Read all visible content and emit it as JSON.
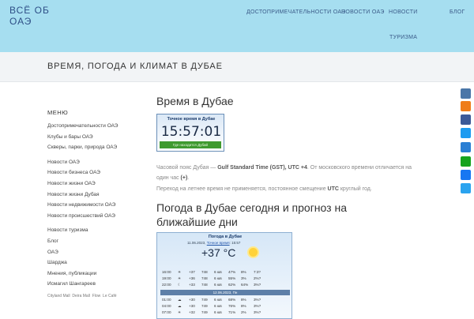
{
  "header": {
    "logo": "ВСЁ ОБ ОАЭ",
    "nav": [
      "ДОСТОПРИМЕЧАТЕЛЬНОСТИ ОАЭ",
      "НОВОСТИ ОАЭ",
      "НОВОСТИ",
      "ТУРИЗМА",
      "БЛОГ"
    ]
  },
  "page_title": "ВРЕМЯ, ПОГОДА И КЛИМАТ В ДУБАЕ",
  "sidebar": {
    "heading": "МЕНЮ",
    "items": [
      "Достопримечательности ОАЭ",
      "Клубы и бары ОАЭ",
      "Скверы, парки, природа ОАЭ",
      "Новости ОАЭ",
      "Новости бизнеса ОАЭ",
      "Новости жизни ОАЭ",
      "Новости жизни Дубая",
      "Новости недвижимости ОАЭ",
      "Новости происшествий ОАЭ",
      "Новости туризма",
      "Блог",
      "ОАЭ",
      "Шарджа",
      "Мнения, публикации",
      "Исмагил Шангареев"
    ],
    "small_links": [
      "Cityland Mall",
      "Deira Mall",
      "Flow",
      "Le Café"
    ]
  },
  "main": {
    "h2_time": "Время в Дубае",
    "clock": {
      "title": "Точное время в Дубае",
      "time": "15:57:01",
      "footer": "Где находится Дубай"
    },
    "p1_pre": "Часовой пояс Дубая — ",
    "p1_bold": "Gulf Standard Time (GST), UTC +4",
    "p1_post": ". От московского времени отличается на один час ",
    "p1_bold2": "(+)",
    "p2_pre": "Переход на летнее время не применяется, постоянное смещение ",
    "p2_bold": "UTC",
    "p2_post": " круглый год.",
    "h2_weather": "Погода в Дубае сегодня и прогноз на ближайшие дни"
  },
  "weather": {
    "title": "Погода в Дубае",
    "date": "11.06.2023",
    "link": "Точное время",
    "time": "15:57",
    "temp": "+37 °C",
    "rows": [
      [
        "16:00",
        "+37",
        "748",
        "6 юв",
        "47%",
        "8%",
        "7:3?"
      ],
      [
        "19:00",
        "+36",
        "748",
        "6 юв",
        "55%",
        "3%",
        "2%?"
      ],
      [
        "22:00",
        "+33",
        "748",
        "6 юв",
        "62%",
        "64%",
        "3%?"
      ]
    ],
    "date_bar": "12.06.2023, Пн",
    "rows2": [
      [
        "01:00",
        "+30",
        "749",
        "6 юв",
        "68%",
        "8%",
        "3%?"
      ],
      [
        "04:00",
        "+30",
        "749",
        "6 юв",
        "76%",
        "8%",
        "3%?"
      ],
      [
        "07:00",
        "+32",
        "749",
        "6 юв",
        "71%",
        "2%",
        "3%?"
      ]
    ]
  },
  "social_colors": [
    "#4a76a8",
    "#ef7d1a",
    "#3b5998",
    "#1d9bf0",
    "#2a7fd4",
    "#16a31f",
    "#1877f2",
    "#2aa3ef"
  ]
}
